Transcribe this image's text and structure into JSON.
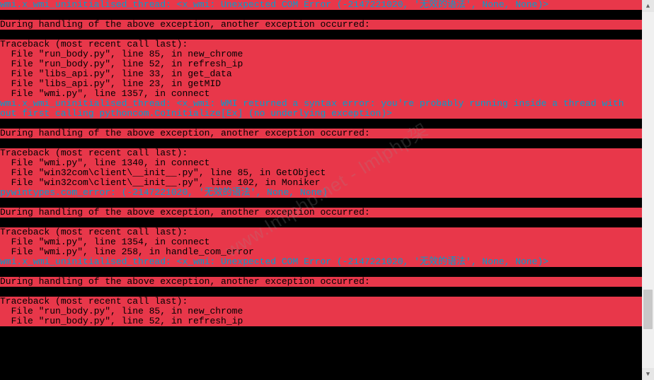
{
  "watermark": "www.lmlphp.net - lmlphp架",
  "scrollbar": {
    "up_glyph": "▲",
    "down_glyph": "▼"
  },
  "lines": [
    {
      "hl": true,
      "cyan": true,
      "text": "wmi.x_wmi_uninitialised_thread: <x_wmi: Unexpected COM Error (-2147221020, '无效的语法', None, None)>"
    },
    {
      "hl": false,
      "cyan": false,
      "text": ""
    },
    {
      "hl": true,
      "cyan": false,
      "text": "During handling of the above exception, another exception occurred:"
    },
    {
      "hl": false,
      "cyan": false,
      "text": ""
    },
    {
      "hl": true,
      "cyan": false,
      "text": "Traceback (most recent call last):"
    },
    {
      "hl": true,
      "cyan": false,
      "text": "  File \"run_body.py\", line 85, in new_chrome"
    },
    {
      "hl": true,
      "cyan": false,
      "text": "  File \"run_body.py\", line 52, in refresh_ip"
    },
    {
      "hl": true,
      "cyan": false,
      "text": "  File \"libs_api.py\", line 33, in get_data"
    },
    {
      "hl": true,
      "cyan": false,
      "text": "  File \"libs_api.py\", line 23, in getMID"
    },
    {
      "hl": true,
      "cyan": false,
      "text": "  File \"wmi.py\", line 1357, in connect"
    },
    {
      "hl": true,
      "cyan": true,
      "text": "wmi.x_wmi_uninitialised_thread: <x_wmi: WMI returned a syntax error: you're probably running inside a thread with"
    },
    {
      "hl": true,
      "cyan": true,
      "text": "out first calling pythoncom.CoInitialize[Ex] (no underlying exception)>"
    },
    {
      "hl": false,
      "cyan": false,
      "text": ""
    },
    {
      "hl": true,
      "cyan": false,
      "text": "During handling of the above exception, another exception occurred:"
    },
    {
      "hl": false,
      "cyan": false,
      "text": ""
    },
    {
      "hl": true,
      "cyan": false,
      "text": "Traceback (most recent call last):"
    },
    {
      "hl": true,
      "cyan": false,
      "text": "  File \"wmi.py\", line 1340, in connect"
    },
    {
      "hl": true,
      "cyan": false,
      "text": "  File \"win32com\\client\\__init__.py\", line 85, in GetObject"
    },
    {
      "hl": true,
      "cyan": false,
      "text": "  File \"win32com\\client\\__init__.py\", line 102, in Moniker"
    },
    {
      "hl": true,
      "cyan": true,
      "text": "pywintypes.com_error: (-2147221020, '无效的语法', None, None)"
    },
    {
      "hl": false,
      "cyan": false,
      "text": ""
    },
    {
      "hl": true,
      "cyan": false,
      "text": "During handling of the above exception, another exception occurred:"
    },
    {
      "hl": false,
      "cyan": false,
      "text": ""
    },
    {
      "hl": true,
      "cyan": false,
      "text": "Traceback (most recent call last):"
    },
    {
      "hl": true,
      "cyan": false,
      "text": "  File \"wmi.py\", line 1354, in connect"
    },
    {
      "hl": true,
      "cyan": false,
      "text": "  File \"wmi.py\", line 258, in handle_com_error"
    },
    {
      "hl": true,
      "cyan": true,
      "text": "wmi.x_wmi_uninitialised_thread: <x_wmi: Unexpected COM Error (-2147221020, '无效的语法', None, None)>"
    },
    {
      "hl": false,
      "cyan": false,
      "text": ""
    },
    {
      "hl": true,
      "cyan": false,
      "text": "During handling of the above exception, another exception occurred:"
    },
    {
      "hl": false,
      "cyan": false,
      "text": ""
    },
    {
      "hl": true,
      "cyan": false,
      "text": "Traceback (most recent call last):"
    },
    {
      "hl": true,
      "cyan": false,
      "text": "  File \"run_body.py\", line 85, in new_chrome"
    },
    {
      "hl": true,
      "cyan": false,
      "text": "  File \"run_body.py\", line 52, in refresh_ip"
    }
  ]
}
